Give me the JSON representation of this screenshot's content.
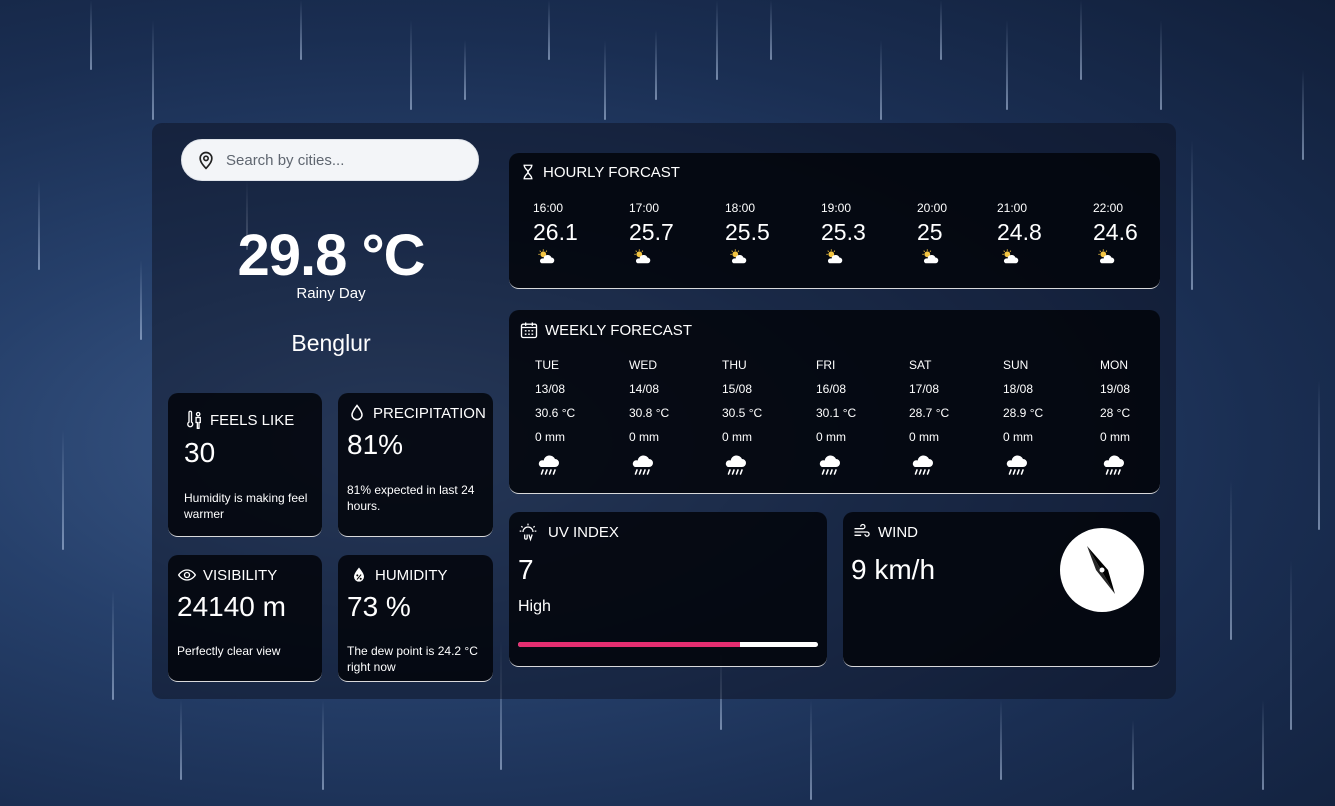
{
  "search": {
    "placeholder": "Search by cities..."
  },
  "current": {
    "temperature": "29.8 °C",
    "condition": "Rainy Day",
    "city": "Benglur"
  },
  "feels_like": {
    "title": "FEELS LIKE",
    "value": "30",
    "note": "Humidity is making feel warmer"
  },
  "precipitation": {
    "title": "PRECIPITATION",
    "value": "81%",
    "note": "81% expected in last 24 hours."
  },
  "visibility": {
    "title": "VISIBILITY",
    "value": "24140 m",
    "note": "Perfectly clear view"
  },
  "humidity": {
    "title": "HUMIDITY",
    "value": "73 %",
    "note": "The dew point is 24.2 °C right now"
  },
  "hourly": {
    "title": "HOURLY FORCAST",
    "items": [
      {
        "time": "16:00",
        "temp": "26.1",
        "icon": "partly-cloudy-icon"
      },
      {
        "time": "17:00",
        "temp": "25.7",
        "icon": "partly-cloudy-icon"
      },
      {
        "time": "18:00",
        "temp": "25.5",
        "icon": "partly-cloudy-icon"
      },
      {
        "time": "19:00",
        "temp": "25.3",
        "icon": "partly-cloudy-icon"
      },
      {
        "time": "20:00",
        "temp": "25",
        "icon": "partly-cloudy-icon"
      },
      {
        "time": "21:00",
        "temp": "24.8",
        "icon": "partly-cloudy-icon"
      },
      {
        "time": "22:00",
        "temp": "24.6",
        "icon": "partly-cloudy-icon"
      }
    ]
  },
  "weekly": {
    "title": "WEEKLY FORECAST",
    "items": [
      {
        "day": "TUE",
        "date": "13/08",
        "temp": "30.6 °C",
        "rain": "0 mm",
        "icon": "rain-cloud-icon"
      },
      {
        "day": "WED",
        "date": "14/08",
        "temp": "30.8 °C",
        "rain": "0 mm",
        "icon": "rain-cloud-icon"
      },
      {
        "day": "THU",
        "date": "15/08",
        "temp": "30.5 °C",
        "rain": "0 mm",
        "icon": "rain-cloud-icon"
      },
      {
        "day": "FRI",
        "date": "16/08",
        "temp": "30.1 °C",
        "rain": "0 mm",
        "icon": "rain-cloud-icon"
      },
      {
        "day": "SAT",
        "date": "17/08",
        "temp": "28.7 °C",
        "rain": "0 mm",
        "icon": "rain-cloud-icon"
      },
      {
        "day": "SUN",
        "date": "18/08",
        "temp": "28.9 °C",
        "rain": "0 mm",
        "icon": "rain-cloud-icon"
      },
      {
        "day": "MON",
        "date": "19/08",
        "temp": "28 °C",
        "rain": "0 mm",
        "icon": "rain-cloud-icon"
      }
    ]
  },
  "uv": {
    "title": "UV INDEX",
    "value": "7",
    "level": "High",
    "bar_fraction": 0.74,
    "bar_color": "#e52e71"
  },
  "wind": {
    "title": "WIND",
    "value": "9 km/h"
  },
  "colors": {
    "card_bg": "#05080e",
    "accent": "#e52e71",
    "text": "#ffffff"
  }
}
